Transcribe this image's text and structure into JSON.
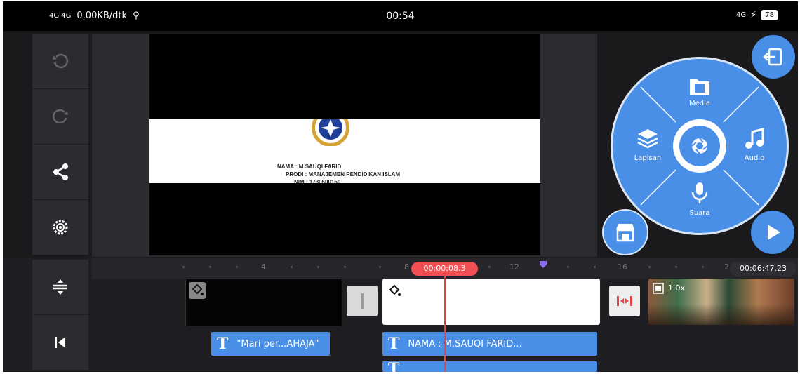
{
  "status_bar": {
    "network_left": "4G 4G",
    "speed": "0.00KB/dtk",
    "time": "00:54",
    "network_right": "4G",
    "battery": "78"
  },
  "preview": {
    "name_line": "NAMA : M.SAUQI FARID",
    "prodi_line": "PRODI : MANAJEMEN PENDIDIKAN ISLAM",
    "nim_line": "NIM : 1730500150"
  },
  "circle_menu": {
    "media": "Media",
    "layer": "Lapisan",
    "audio": "Audio",
    "voice": "Suara"
  },
  "timeline": {
    "ticks": [
      "4",
      "8",
      "12",
      "16",
      "2"
    ],
    "current_time": "00:00:08.3",
    "total_time": "00:06:47.23",
    "speed_badge": "1.0x",
    "text_layer_1": "\"Mari per...AHAJA\"",
    "text_layer_2": "NAMA : M.SAUQI FARID...",
    "text_icon": "T"
  },
  "icons": [
    "undo-icon",
    "redo-icon",
    "share-icon",
    "settings-icon",
    "adjust-icon",
    "skip-start-icon",
    "export-icon",
    "store-icon",
    "play-icon",
    "camera-icon",
    "media-icon",
    "layer-icon",
    "audio-icon",
    "mic-icon",
    "fill-icon",
    "transition-icon"
  ],
  "colors": {
    "accent": "#4a8fe7",
    "playhead": "#f24f54",
    "panel": "#2c2c30"
  }
}
